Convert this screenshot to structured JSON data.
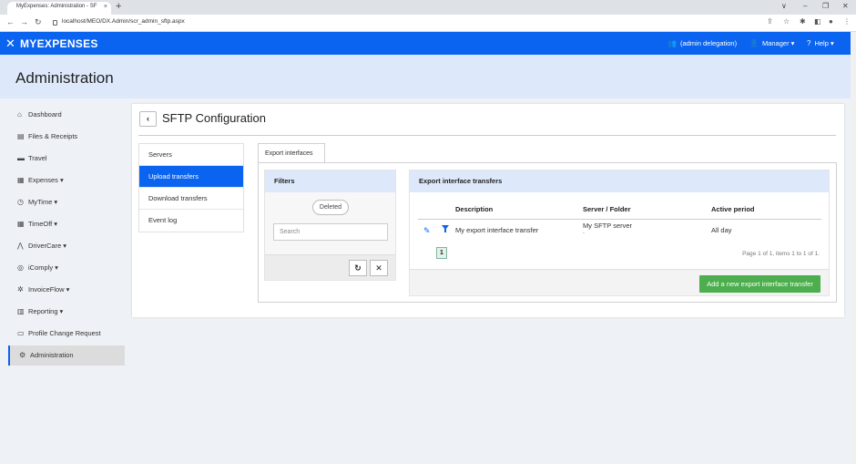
{
  "browser": {
    "tab_title": "MyExpenses: Administration - SF",
    "tab_close": "×",
    "new_tab": "+",
    "url": "localhost/MEO/DX.Admin/scr_admin_sftp.aspx",
    "controls": {
      "minimize": "∨",
      "restore": "–",
      "maximize": "❐",
      "close": "✕"
    }
  },
  "header": {
    "logo": "MYEXPENSES",
    "delegation": "(admin delegation)",
    "user_menu": "Manager",
    "help_menu": "Help"
  },
  "page": {
    "title": "Administration"
  },
  "sidebar": {
    "items": [
      {
        "label": "Dashboard",
        "icon": "home-icon",
        "glyph": "⌂"
      },
      {
        "label": "Files & Receipts",
        "icon": "image-icon",
        "glyph": "▤"
      },
      {
        "label": "Travel",
        "icon": "suitcase-icon",
        "glyph": "▬"
      },
      {
        "label": "Expenses",
        "icon": "calculator-icon",
        "glyph": "▦",
        "caret": "▾"
      },
      {
        "label": "MyTime",
        "icon": "stopwatch-icon",
        "glyph": "◷",
        "caret": "▾"
      },
      {
        "label": "TimeOff",
        "icon": "calendar-icon",
        "glyph": "▦",
        "caret": "▾"
      },
      {
        "label": "DriverCare",
        "icon": "road-icon",
        "glyph": "⋀",
        "caret": "▾"
      },
      {
        "label": "iComply",
        "icon": "shield-icon",
        "glyph": "◎",
        "caret": "▾"
      },
      {
        "label": "InvoiceFlow",
        "icon": "flow-icon",
        "glyph": "✲",
        "caret": "▾"
      },
      {
        "label": "Reporting",
        "icon": "chart-icon",
        "glyph": "▥",
        "caret": "▾"
      },
      {
        "label": "Profile Change Request",
        "icon": "inbox-icon",
        "glyph": "▭"
      },
      {
        "label": "Administration",
        "icon": "cogs-icon",
        "glyph": "⚙",
        "active": true
      }
    ]
  },
  "sftp": {
    "back": "‹",
    "title": "SFTP Configuration",
    "subnav": [
      "Servers",
      "Upload transfers",
      "Download transfers",
      "Event log"
    ],
    "active_subnav": "Upload transfers",
    "tab": "Export interfaces",
    "filters": {
      "title": "Filters",
      "deleted_toggle": "Deleted",
      "search_placeholder": "Search",
      "refresh_glyph": "↻",
      "clear_glyph": "✕"
    },
    "transfers": {
      "title": "Export interface transfers",
      "columns": [
        "Description",
        "Server / Folder",
        "Active period"
      ],
      "rows": [
        {
          "description": "My export interface transfer",
          "server": "My SFTP server",
          "folder": "-",
          "period": "All day"
        }
      ],
      "page_current": "1",
      "page_info": "Page 1 of 1, items 1 to 1 of 1.",
      "add_button": "Add a new export interface transfer",
      "edit_glyph": "✎"
    }
  },
  "colors": {
    "brand": "#0a64f0",
    "page_header": "#dde9fb",
    "success": "#4cae4c"
  }
}
